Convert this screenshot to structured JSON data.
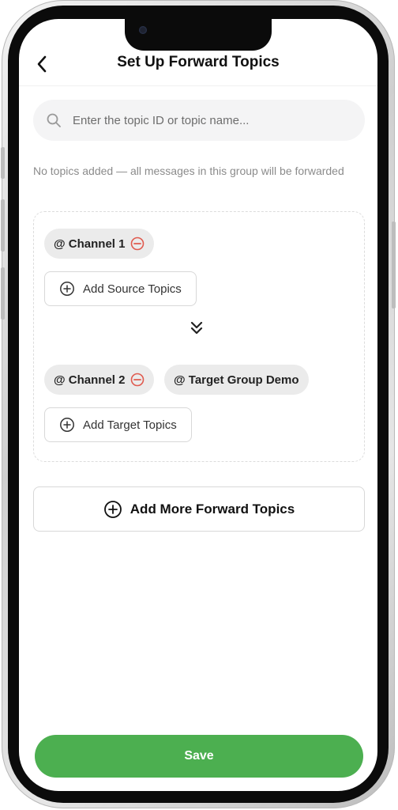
{
  "header": {
    "title": "Set Up Forward Topics",
    "back_icon": "chevron-left-icon"
  },
  "search": {
    "placeholder": "Enter the topic ID or topic name...",
    "value": ""
  },
  "notice": "No topics added — all messages in this group will be forwarded",
  "source": {
    "chips": [
      {
        "label": "@ Channel 1",
        "removable": true
      }
    ],
    "add_label": "Add Source Topics"
  },
  "target": {
    "chips": [
      {
        "label": "@ Channel 2",
        "removable": true
      },
      {
        "label": "@ Target Group Demo",
        "removable": false
      }
    ],
    "add_label": "Add Target Topics"
  },
  "add_more_label": "Add More Forward Topics",
  "save_label": "Save",
  "colors": {
    "accent": "#4caf50",
    "remove": "#e05a4e",
    "chip_bg": "#ebebeb"
  }
}
